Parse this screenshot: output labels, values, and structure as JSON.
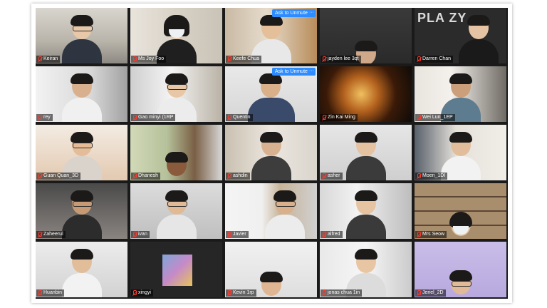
{
  "window": {
    "app": "zoom-gallery-view"
  },
  "buttons": {
    "ask_to_unmute": "Ask to Unmute",
    "more": "···"
  },
  "poster": {
    "text": "PLA    ZY"
  },
  "participants": [
    {
      "name": "Keiran"
    },
    {
      "name": "Ms Joy Foo"
    },
    {
      "name": "Keefe Chua"
    },
    {
      "name": "jayden lee 3qt"
    },
    {
      "name": "Darren Chan"
    },
    {
      "name": "rey"
    },
    {
      "name": "Gao minyi (1RP"
    },
    {
      "name": "Quentin"
    },
    {
      "name": "Zin Kai Ming"
    },
    {
      "name": "Wei Lun_1EP"
    },
    {
      "name": "Guan Quan_3D"
    },
    {
      "name": "Dhanesh"
    },
    {
      "name": "ashdin"
    },
    {
      "name": "asher"
    },
    {
      "name": "Moen_1DI"
    },
    {
      "name": "Zaheerul"
    },
    {
      "name": "ivan"
    },
    {
      "name": "Javier"
    },
    {
      "name": "alfred"
    },
    {
      "name": "Mrs Seow"
    },
    {
      "name": "Huanbin"
    },
    {
      "name": "xingyi"
    },
    {
      "name": "Kevin 1rp"
    },
    {
      "name": "jonas chua 1in"
    },
    {
      "name": "Jeriel_2D"
    }
  ]
}
